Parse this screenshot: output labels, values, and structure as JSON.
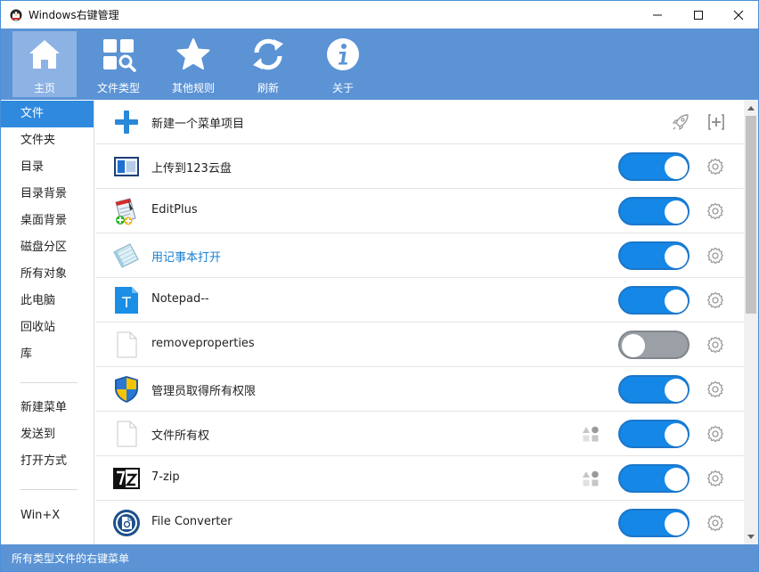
{
  "window": {
    "title": "Windows右键管理"
  },
  "toolbar": {
    "items": [
      {
        "label": "主页",
        "icon": "home-icon",
        "active": true
      },
      {
        "label": "文件类型",
        "icon": "file-types-icon",
        "active": false
      },
      {
        "label": "其他规则",
        "icon": "star-icon",
        "active": false
      },
      {
        "label": "刷新",
        "icon": "refresh-icon",
        "active": false
      },
      {
        "label": "关于",
        "icon": "info-icon",
        "active": false
      }
    ]
  },
  "sidebar": {
    "items": [
      {
        "label": "文件",
        "active": true
      },
      {
        "label": "文件夹"
      },
      {
        "label": "目录"
      },
      {
        "label": "目录背景"
      },
      {
        "label": "桌面背景"
      },
      {
        "label": "磁盘分区"
      },
      {
        "label": "所有对象"
      },
      {
        "label": "此电脑"
      },
      {
        "label": "回收站"
      },
      {
        "label": "库"
      },
      {
        "label": "新建菜单"
      },
      {
        "label": "发送到"
      },
      {
        "label": "打开方式"
      },
      {
        "label": "Win+X"
      }
    ]
  },
  "content": {
    "new_item_label": "新建一个菜单项目",
    "rows": [
      {
        "label": "上传到123云盘",
        "icon": "cloud-upload-icon",
        "enabled": true
      },
      {
        "label": "EditPlus",
        "icon": "editplus-icon",
        "enabled": true
      },
      {
        "label": "用记事本打开",
        "icon": "notepad-icon",
        "enabled": true,
        "highlighted": true
      },
      {
        "label": "Notepad--",
        "icon": "notepad-dash-icon",
        "enabled": true
      },
      {
        "label": "removeproperties",
        "icon": "blank-file-icon",
        "enabled": false
      },
      {
        "label": "管理员取得所有权限",
        "icon": "uac-shield-icon",
        "enabled": true
      },
      {
        "label": "文件所有权",
        "icon": "blank-file-icon",
        "enabled": true,
        "has_extra": true
      },
      {
        "label": "7-zip",
        "icon": "7zip-icon",
        "enabled": true,
        "has_extra": true
      },
      {
        "label": "File Converter",
        "icon": "file-converter-icon",
        "enabled": true
      }
    ]
  },
  "status": {
    "text": "所有类型文件的右键菜单"
  },
  "colors": {
    "accent": "#5b93d5",
    "toggle_on": "#1587e6",
    "toggle_off": "#9aa0a6",
    "sidebar_active": "#2f89dd"
  }
}
